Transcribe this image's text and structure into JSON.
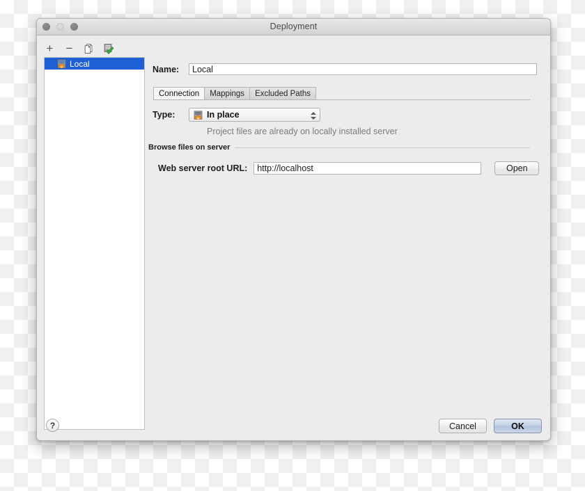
{
  "window": {
    "title": "Deployment",
    "traffic_lights": [
      "close",
      "minimize",
      "zoom"
    ]
  },
  "sidebar": {
    "toolbar": [
      {
        "name": "add",
        "icon": "plus-icon",
        "glyph": "+"
      },
      {
        "name": "remove",
        "icon": "minus-icon",
        "glyph": "−"
      },
      {
        "name": "copy",
        "icon": "copy-pages-icon",
        "glyph": ""
      },
      {
        "name": "set-default",
        "icon": "server-check-icon",
        "glyph": ""
      }
    ],
    "items": [
      {
        "label": "Local",
        "icon": "server-home-icon",
        "selected": true
      }
    ]
  },
  "form": {
    "name_label": "Name:",
    "name_value": "Local",
    "name_placeholder": "",
    "tabs": [
      {
        "label": "Connection",
        "active": true
      },
      {
        "label": "Mappings",
        "active": false
      },
      {
        "label": "Excluded Paths",
        "active": false
      }
    ],
    "type_label": "Type:",
    "type_value": "In place",
    "type_icon": "server-home-icon",
    "type_hint": "Project files are already on locally installed server",
    "section_header": "Browse files on server",
    "url_label": "Web server root URL:",
    "url_value": "http://localhost",
    "url_placeholder": "",
    "open_label": "Open"
  },
  "footer": {
    "help_label": "?",
    "cancel_label": "Cancel",
    "ok_label": "OK"
  },
  "colors": {
    "selection_blue": "#1f5fd6",
    "window_bg": "#ececec",
    "default_button": "#b2c2de",
    "hint_text": "#7b7b7b"
  }
}
